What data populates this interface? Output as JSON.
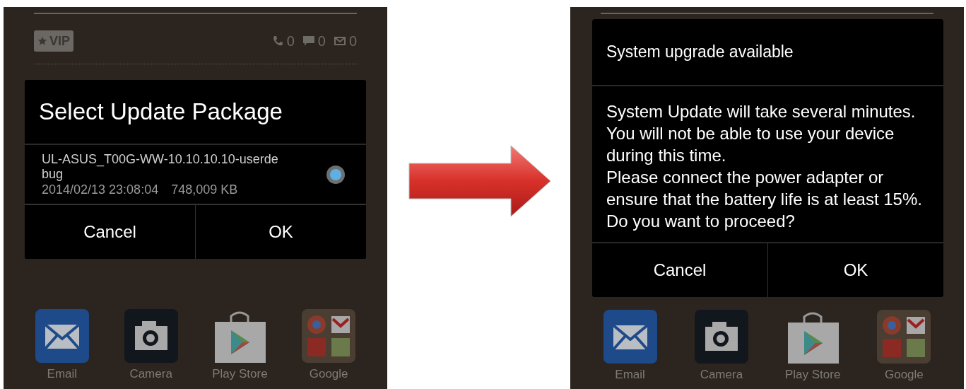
{
  "screens": [
    {
      "status": {
        "vip": "VIP",
        "counts": [
          {
            "kind": "call",
            "value": "0"
          },
          {
            "kind": "message",
            "value": "0"
          },
          {
            "kind": "mail",
            "value": "0"
          }
        ]
      },
      "dialog": {
        "kind": "select",
        "title": "Select Update Package",
        "packages": [
          {
            "name": "UL-ASUS_T00G-WW-10.10.10.10-userdebug",
            "date": "2014/02/13 23:08:04",
            "size": "748,009 KB",
            "selected": true
          }
        ],
        "buttons": [
          "Cancel",
          "OK"
        ]
      },
      "dock": [
        {
          "kind": "email",
          "label": "Email"
        },
        {
          "kind": "camera",
          "label": "Camera"
        },
        {
          "kind": "store",
          "label": "Play Store"
        },
        {
          "kind": "folder",
          "label": "Google"
        }
      ]
    },
    {
      "dialog": {
        "kind": "confirm",
        "title": "System upgrade available",
        "message": "System Update will take several minutes. You will not be able to use your device during this time.\nPlease connect the power adapter or ensure that the battery life is at least 15%.\nDo you want to proceed?",
        "buttons": [
          "Cancel",
          "OK"
        ]
      },
      "dock": [
        {
          "kind": "email",
          "label": "Email"
        },
        {
          "kind": "camera",
          "label": "Camera"
        },
        {
          "kind": "store",
          "label": "Play Store"
        },
        {
          "kind": "folder",
          "label": "Google"
        }
      ]
    }
  ]
}
